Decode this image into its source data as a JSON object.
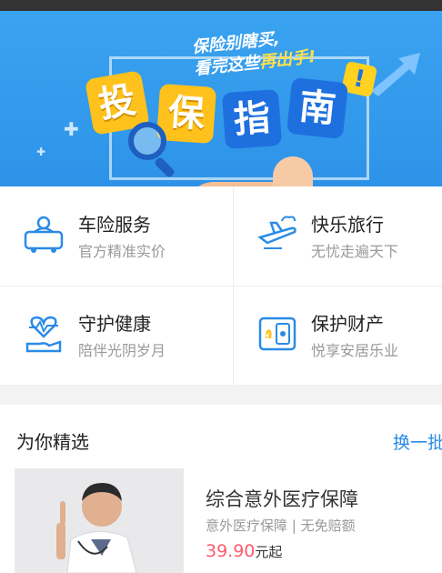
{
  "banner": {
    "slogan_line1": "保险别瞎买,",
    "slogan_line2_pre": "看完这些",
    "slogan_line2_hl": "再出手!",
    "tiles": [
      "投",
      "保",
      "指",
      "南"
    ],
    "excl": "!"
  },
  "services": [
    {
      "title": "车险服务",
      "sub": "官方精准实价",
      "icon": "car-icon"
    },
    {
      "title": "快乐旅行",
      "sub": "无忧走遍天下",
      "icon": "plane-icon"
    },
    {
      "title": "守护健康",
      "sub": "陪伴光阴岁月",
      "icon": "heart-hand-icon"
    },
    {
      "title": "保护财产",
      "sub": "悦享安居乐业",
      "icon": "safe-icon"
    }
  ],
  "picks": {
    "title": "为你精选",
    "more": "换一批"
  },
  "product": {
    "name": "综合意外医疗保障",
    "desc": "意外医疗保障 | 无免赔额",
    "price": "39.90",
    "price_unit": "元起"
  },
  "colors": {
    "accent": "#2a8be6",
    "price": "#ff5a6a",
    "banner": "#3aa3f0"
  }
}
